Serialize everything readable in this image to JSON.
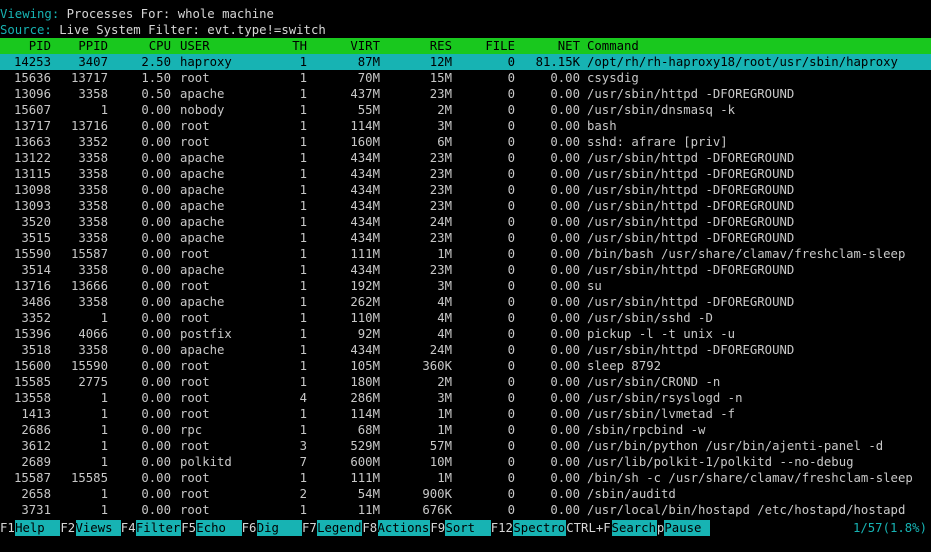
{
  "header": {
    "viewing_label": "Viewing:",
    "viewing_text": " Processes For: whole machine",
    "source_label": "Source:",
    "source_text": " Live System Filter: evt.type!=switch"
  },
  "columns": [
    "PID",
    "PPID",
    "CPU",
    "USER",
    "TH",
    "VIRT",
    "RES",
    "FILE",
    "NET",
    "Command"
  ],
  "rows": [
    [
      "14253",
      "3407",
      "2.50",
      "haproxy",
      "1",
      "87M",
      "12M",
      "0",
      "81.15K",
      "/opt/rh/rh-haproxy18/root/usr/sbin/haproxy"
    ],
    [
      "15636",
      "13717",
      "1.50",
      "root",
      "1",
      "70M",
      "15M",
      "0",
      "0.00",
      "csysdig"
    ],
    [
      "13096",
      "3358",
      "0.50",
      "apache",
      "1",
      "437M",
      "23M",
      "0",
      "0.00",
      "/usr/sbin/httpd -DFOREGROUND"
    ],
    [
      "15607",
      "1",
      "0.00",
      "nobody",
      "1",
      "55M",
      "2M",
      "0",
      "0.00",
      "/usr/sbin/dnsmasq -k"
    ],
    [
      "13717",
      "13716",
      "0.00",
      "root",
      "1",
      "114M",
      "3M",
      "0",
      "0.00",
      "bash"
    ],
    [
      "13663",
      "3352",
      "0.00",
      "root",
      "1",
      "160M",
      "6M",
      "0",
      "0.00",
      "sshd: afrare [priv]"
    ],
    [
      "13122",
      "3358",
      "0.00",
      "apache",
      "1",
      "434M",
      "23M",
      "0",
      "0.00",
      "/usr/sbin/httpd -DFOREGROUND"
    ],
    [
      "13115",
      "3358",
      "0.00",
      "apache",
      "1",
      "434M",
      "23M",
      "0",
      "0.00",
      "/usr/sbin/httpd -DFOREGROUND"
    ],
    [
      "13098",
      "3358",
      "0.00",
      "apache",
      "1",
      "434M",
      "23M",
      "0",
      "0.00",
      "/usr/sbin/httpd -DFOREGROUND"
    ],
    [
      "13093",
      "3358",
      "0.00",
      "apache",
      "1",
      "434M",
      "23M",
      "0",
      "0.00",
      "/usr/sbin/httpd -DFOREGROUND"
    ],
    [
      "3520",
      "3358",
      "0.00",
      "apache",
      "1",
      "434M",
      "24M",
      "0",
      "0.00",
      "/usr/sbin/httpd -DFOREGROUND"
    ],
    [
      "3515",
      "3358",
      "0.00",
      "apache",
      "1",
      "434M",
      "23M",
      "0",
      "0.00",
      "/usr/sbin/httpd -DFOREGROUND"
    ],
    [
      "15590",
      "15587",
      "0.00",
      "root",
      "1",
      "111M",
      "1M",
      "0",
      "0.00",
      "/bin/bash /usr/share/clamav/freshclam-sleep"
    ],
    [
      "3514",
      "3358",
      "0.00",
      "apache",
      "1",
      "434M",
      "23M",
      "0",
      "0.00",
      "/usr/sbin/httpd -DFOREGROUND"
    ],
    [
      "13716",
      "13666",
      "0.00",
      "root",
      "1",
      "192M",
      "3M",
      "0",
      "0.00",
      "su"
    ],
    [
      "3486",
      "3358",
      "0.00",
      "apache",
      "1",
      "262M",
      "4M",
      "0",
      "0.00",
      "/usr/sbin/httpd -DFOREGROUND"
    ],
    [
      "3352",
      "1",
      "0.00",
      "root",
      "1",
      "110M",
      "4M",
      "0",
      "0.00",
      "/usr/sbin/sshd -D"
    ],
    [
      "15396",
      "4066",
      "0.00",
      "postfix",
      "1",
      "92M",
      "4M",
      "0",
      "0.00",
      "pickup -l -t unix -u"
    ],
    [
      "3518",
      "3358",
      "0.00",
      "apache",
      "1",
      "434M",
      "24M",
      "0",
      "0.00",
      "/usr/sbin/httpd -DFOREGROUND"
    ],
    [
      "15600",
      "15590",
      "0.00",
      "root",
      "1",
      "105M",
      "360K",
      "0",
      "0.00",
      "sleep 8792"
    ],
    [
      "15585",
      "2775",
      "0.00",
      "root",
      "1",
      "180M",
      "2M",
      "0",
      "0.00",
      "/usr/sbin/CROND -n"
    ],
    [
      "13558",
      "1",
      "0.00",
      "root",
      "4",
      "286M",
      "3M",
      "0",
      "0.00",
      "/usr/sbin/rsyslogd -n"
    ],
    [
      "1413",
      "1",
      "0.00",
      "root",
      "1",
      "114M",
      "1M",
      "0",
      "0.00",
      "/usr/sbin/lvmetad -f"
    ],
    [
      "2686",
      "1",
      "0.00",
      "rpc",
      "1",
      "68M",
      "1M",
      "0",
      "0.00",
      "/sbin/rpcbind -w"
    ],
    [
      "3612",
      "1",
      "0.00",
      "root",
      "3",
      "529M",
      "57M",
      "0",
      "0.00",
      "/usr/bin/python /usr/bin/ajenti-panel -d"
    ],
    [
      "2689",
      "1",
      "0.00",
      "polkitd",
      "7",
      "600M",
      "10M",
      "0",
      "0.00",
      "/usr/lib/polkit-1/polkitd --no-debug"
    ],
    [
      "15587",
      "15585",
      "0.00",
      "root",
      "1",
      "111M",
      "1M",
      "0",
      "0.00",
      "/bin/sh -c /usr/share/clamav/freshclam-sleep"
    ],
    [
      "2658",
      "1",
      "0.00",
      "root",
      "2",
      "54M",
      "900K",
      "0",
      "0.00",
      "/sbin/auditd"
    ],
    [
      "3731",
      "1",
      "0.00",
      "root",
      "1",
      "11M",
      "676K",
      "0",
      "0.00",
      "/usr/local/bin/hostapd /etc/hostapd/hostapd"
    ]
  ],
  "footer": {
    "keys": [
      {
        "key": "F1",
        "label": "Help"
      },
      {
        "key": "F2",
        "label": "Views"
      },
      {
        "key": "F4",
        "label": "Filter"
      },
      {
        "key": "F5",
        "label": "Echo"
      },
      {
        "key": "F6",
        "label": "Dig"
      },
      {
        "key": "F7",
        "label": "Legend"
      },
      {
        "key": "F8",
        "label": "Actions"
      },
      {
        "key": "F9",
        "label": "Sort"
      },
      {
        "key": "F12",
        "label": "Spectro"
      },
      {
        "key": "CTRL+F",
        "label": "Search"
      },
      {
        "key": "p",
        "label": "Pause"
      }
    ],
    "status": "1/57(1.8%)"
  },
  "colors": {
    "header_bar": "#19c81e",
    "selected_row": "#17b3b3",
    "accent": "#17b3b3",
    "background": "#000000"
  }
}
